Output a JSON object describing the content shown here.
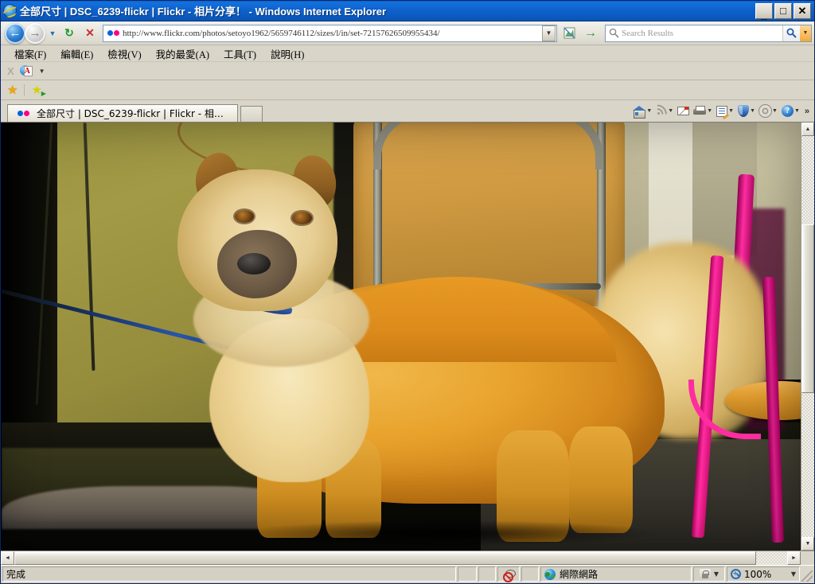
{
  "window": {
    "title": "全部尺寸 | DSC_6239-flickr | Flickr - 相片分享！ - Windows Internet Explorer",
    "app_icon": "ie-logo-icon",
    "minimize_label": "_",
    "maximize_label": "□",
    "close_label": "✕"
  },
  "toolbar": {
    "back_label": "←",
    "forward_label": "→",
    "history_dropdown_label": "▼",
    "refresh_label": "↻",
    "stop_label": "✕",
    "address_url": "http://www.flickr.com/photos/setoyo1962/5659746112/sizes/l/in/set-72157626509955434/",
    "address_dropdown_label": "▼",
    "compat_view_label": "",
    "go_label": "→",
    "search_placeholder": "Search Results",
    "search_value": "",
    "search_dropdown_label": "▼"
  },
  "menubar": {
    "items": [
      {
        "label": "檔案",
        "mnemonic": "(F)"
      },
      {
        "label": "編輯",
        "mnemonic": "(E)"
      },
      {
        "label": "檢視",
        "mnemonic": "(V)"
      },
      {
        "label": "我的最愛",
        "mnemonic": "(A)"
      },
      {
        "label": "工具",
        "mnemonic": "(T)"
      },
      {
        "label": "說明",
        "mnemonic": "(H)"
      }
    ]
  },
  "pdfbar": {
    "close_label": "X",
    "pdf_icon_name": "adobe-pdf-icon",
    "dropdown_label": "▼"
  },
  "favbar": {
    "favorites_label": "★",
    "add_to_favorites_label": "★"
  },
  "tabs": {
    "active": {
      "label": "全部尺寸 | DSC_6239-flickr | Flickr - 相片分享！",
      "favicon": "flickr-dots-icon"
    },
    "new_tab_label": ""
  },
  "command_icons": [
    {
      "name": "home-icon",
      "label": "",
      "has_dropdown": true
    },
    {
      "name": "rss-feed-icon",
      "label": "◉",
      "has_dropdown": true
    },
    {
      "name": "mail-icon",
      "label": "",
      "has_dropdown": false
    },
    {
      "name": "print-icon",
      "label": "",
      "has_dropdown": true
    },
    {
      "name": "page-icon",
      "label": "",
      "has_dropdown": true
    },
    {
      "name": "safety-shield-icon",
      "label": "",
      "has_dropdown": true
    },
    {
      "name": "tools-gear-icon",
      "label": "",
      "has_dropdown": true
    },
    {
      "name": "help-icon",
      "label": "?",
      "has_dropdown": true
    }
  ],
  "more_commands_label": "»",
  "page": {
    "photo_alt": "Large golden-tan long-haired dog standing in front of an olive-green wall, a metal folding chair with wooden back, and a pink chair with wooden seat on a dark floor",
    "photo_title": "DSC_6239-flickr"
  },
  "scrollbars": {
    "vertical": {
      "up_label": "▲",
      "down_label": "▼",
      "thumb_top_pct": 22,
      "thumb_height_pct": 42
    },
    "horizontal": {
      "left_label": "◄",
      "right_label": "►",
      "thumb_left_pct": 0,
      "thumb_width_pct": 96
    }
  },
  "statusbar": {
    "status_text": "完成",
    "blocked_icon_name": "popup-blocked-icon",
    "zone_icon_name": "internet-zone-globe-icon",
    "zone_text": "網際網路",
    "protected_mode_icon": "lock-icon",
    "protected_dropdown_label": "▼",
    "zoom_icon_name": "zoom-magnifier-icon",
    "zoom_level": "100%",
    "zoom_dropdown_label": "▼"
  },
  "colors": {
    "titlebar_blue": "#0f63cf",
    "chrome_beige": "#d9d5c9",
    "flickr_blue": "#0063dc",
    "flickr_pink": "#ff0084",
    "accent_green": "#1e9b2e",
    "accent_red": "#c83030"
  }
}
